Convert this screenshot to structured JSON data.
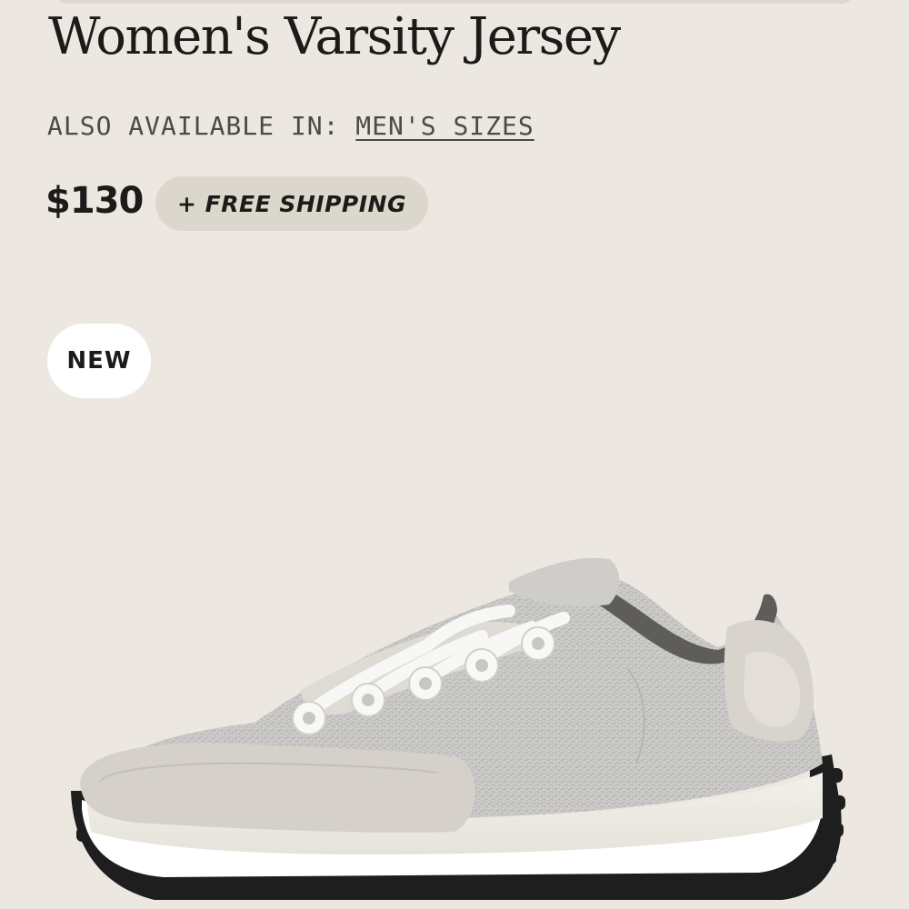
{
  "product": {
    "title": "Women's Varsity Jersey",
    "also_available_label": "ALSO AVAILABLE IN:",
    "also_available_link": "MEN'S SIZES",
    "price": "$130",
    "shipping_badge": "+ FREE SHIPPING",
    "new_badge": "NEW",
    "image_icon": "sneaker-image"
  },
  "colors": {
    "background": "#ece8e1",
    "pill": "#dcd7cd",
    "text": "#1c1b19"
  }
}
